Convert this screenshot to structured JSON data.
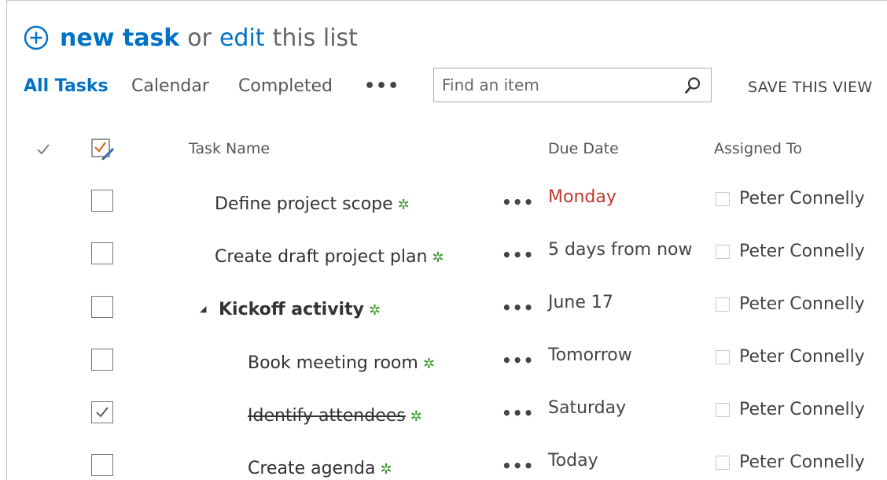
{
  "header": {
    "new_task_label": "new task",
    "or_label": "or",
    "edit_label": "edit",
    "this_list_label": "this list"
  },
  "nav": {
    "all_tasks": "All Tasks",
    "calendar": "Calendar",
    "completed": "Completed",
    "more": "•••",
    "search_placeholder": "Find an item",
    "save_view": "SAVE THIS VIEW"
  },
  "columns": {
    "task_name": "Task Name",
    "due_date": "Due Date",
    "assigned_to": "Assigned To"
  },
  "colors": {
    "accent": "#0072c6",
    "overdue": "#c0392b",
    "new_star": "#3a9a2f"
  },
  "rows": [
    {
      "task": "Define project scope",
      "due": "Monday",
      "assigned": "Peter Connelly",
      "checked": false,
      "overdue": true
    },
    {
      "task": "Create draft project plan",
      "due": "5 days from now",
      "assigned": "Peter Connelly",
      "checked": false
    },
    {
      "task": "Kickoff activity",
      "due": "June 17",
      "assigned": "Peter Connelly",
      "checked": false,
      "summary": true
    },
    {
      "task": "Book meeting room",
      "due": "Tomorrow",
      "assigned": "Peter Connelly",
      "checked": false
    },
    {
      "task": "Identify attendees",
      "due": "Saturday",
      "assigned": "Peter Connelly",
      "checked": true
    },
    {
      "task": "Create agenda",
      "due": "Today",
      "assigned": "Peter Connelly",
      "checked": false
    }
  ],
  "row_ellipsis": "•••",
  "new_marker": "✲",
  "expand_glyph": "◢"
}
